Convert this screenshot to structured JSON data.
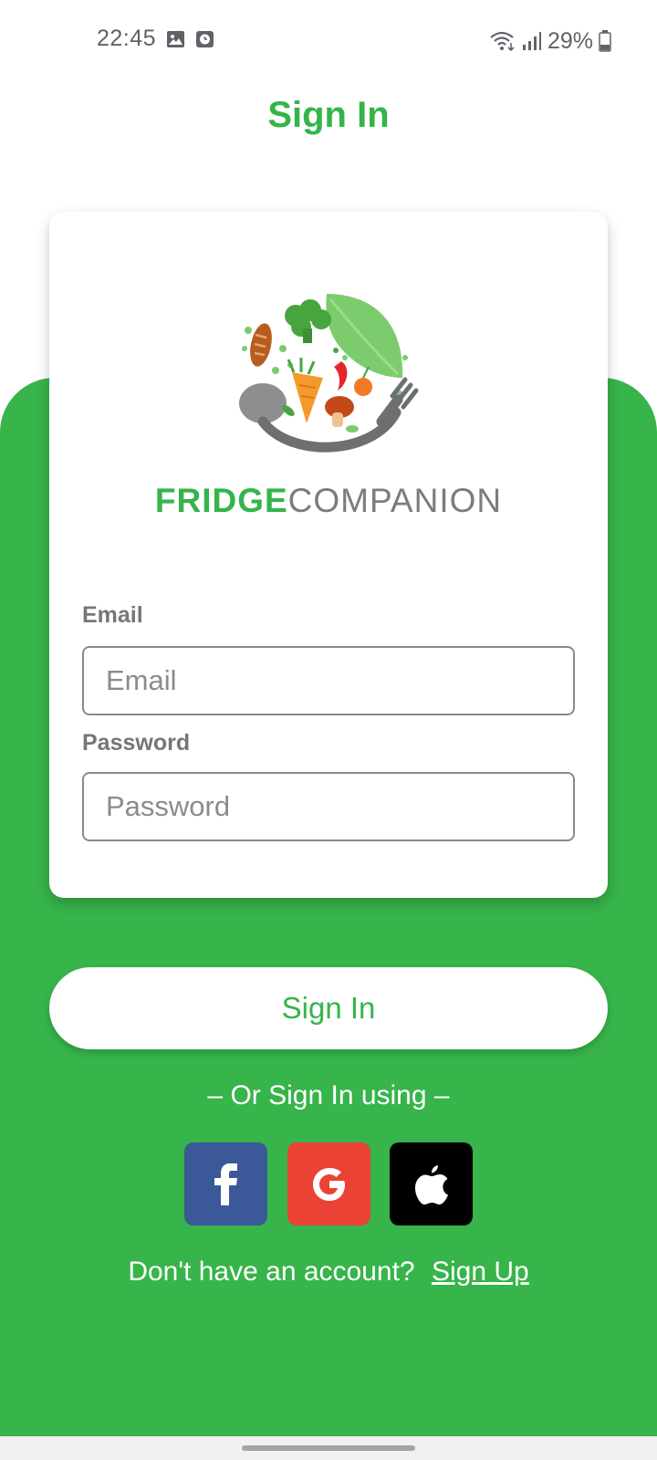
{
  "status_bar": {
    "time": "22:45",
    "icons_left": [
      "image-icon",
      "clock-icon"
    ],
    "icons_right": [
      "wifi-icon",
      "signal-icon",
      "battery-icon"
    ],
    "battery": "29%"
  },
  "header": {
    "title": "Sign In"
  },
  "brand": {
    "name_bold": "FRIDGE",
    "name_light": "COMPANION"
  },
  "form": {
    "email": {
      "label": "Email",
      "placeholder": "Email",
      "value": ""
    },
    "password": {
      "label": "Password",
      "placeholder": "Password",
      "value": ""
    }
  },
  "actions": {
    "sign_in_label": "Sign In",
    "or_text": "– Or Sign In using –",
    "social": [
      {
        "name": "facebook",
        "icon": "facebook-icon",
        "color": "#3b5998"
      },
      {
        "name": "google",
        "icon": "google-icon",
        "color": "#ea4335"
      },
      {
        "name": "apple",
        "icon": "apple-icon",
        "color": "#000000"
      }
    ],
    "signup_prompt": "Don't have an account?",
    "signup_link": "Sign Up"
  },
  "colors": {
    "brand_green": "#37b44a",
    "text_gray": "#767676"
  }
}
